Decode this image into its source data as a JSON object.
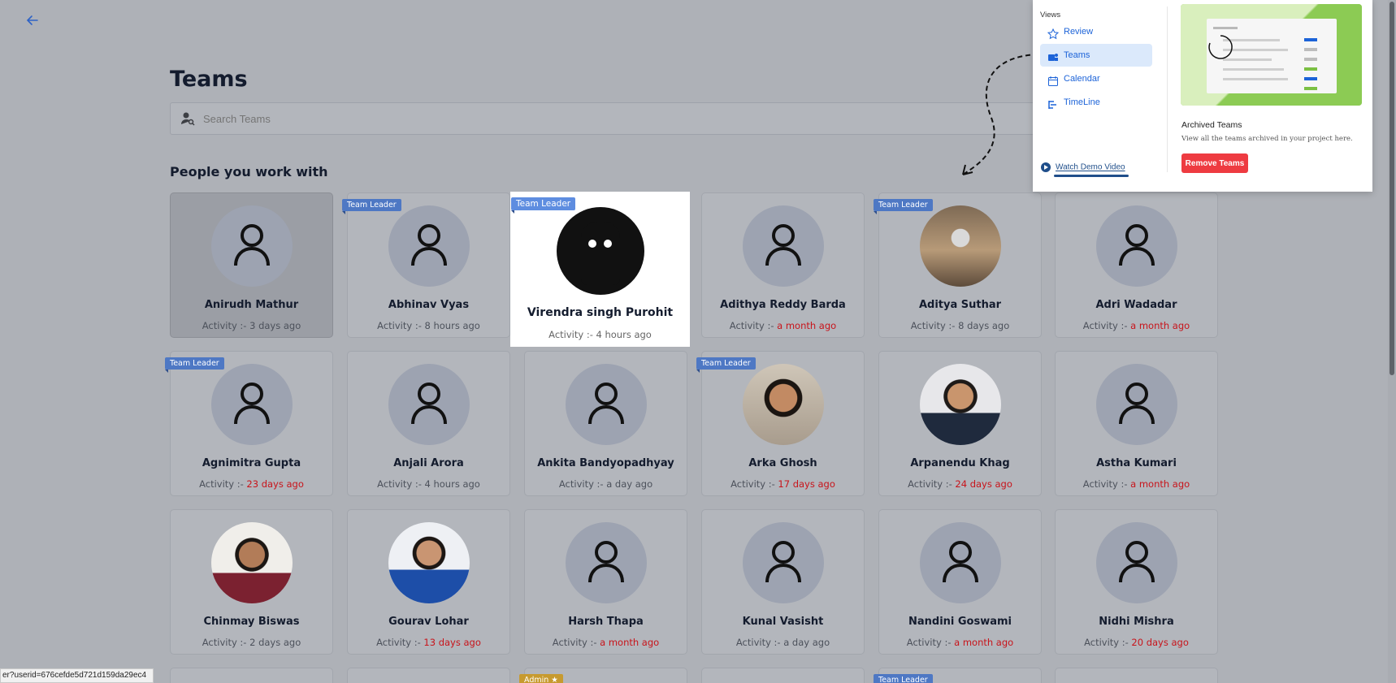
{
  "page": {
    "title": "Teams",
    "search_placeholder": "Search Teams",
    "section_title": "People you work with",
    "status_url": "er?userid=676cefde5d721d159da29ec4"
  },
  "members": [
    {
      "name": "Anirudh Mathur",
      "activity_label": "Activity :-",
      "activity": "3 days ago",
      "recent": true,
      "tag": "",
      "avatar": "placeholder"
    },
    {
      "name": "Abhinav Vyas",
      "activity_label": "Activity :-",
      "activity": "8 hours ago",
      "recent": true,
      "tag": "Team Leader",
      "avatar": "placeholder"
    },
    {
      "name": "Virendra singh Purohit",
      "activity_label": "Activity :-",
      "activity": "4 hours ago",
      "recent": true,
      "tag": "Team Leader",
      "avatar": "cat-art"
    },
    {
      "name": "Adithya Reddy Barda",
      "activity_label": "Activity :-",
      "activity": "a month ago",
      "recent": false,
      "tag": "",
      "avatar": "placeholder"
    },
    {
      "name": "Aditya Suthar",
      "activity_label": "Activity :-",
      "activity": "8 days ago",
      "recent": true,
      "tag": "Team Leader",
      "avatar": "photo"
    },
    {
      "name": "Adri Wadadar",
      "activity_label": "Activity :-",
      "activity": "a month ago",
      "recent": false,
      "tag": "",
      "avatar": "placeholder"
    },
    {
      "name": "Agnimitra Gupta",
      "activity_label": "Activity :-",
      "activity": "23 days ago",
      "recent": false,
      "tag": "Team Leader",
      "avatar": "placeholder"
    },
    {
      "name": "Anjali Arora",
      "activity_label": "Activity :-",
      "activity": "4 hours ago",
      "recent": true,
      "tag": "",
      "avatar": "placeholder"
    },
    {
      "name": "Ankita Bandyopadhyay",
      "activity_label": "Activity :-",
      "activity": "a day ago",
      "recent": true,
      "tag": "",
      "avatar": "placeholder"
    },
    {
      "name": "Arka Ghosh",
      "activity_label": "Activity :-",
      "activity": "17 days ago",
      "recent": false,
      "tag": "Team Leader",
      "avatar": "photo"
    },
    {
      "name": "Arpanendu Khag",
      "activity_label": "Activity :-",
      "activity": "24 days ago",
      "recent": false,
      "tag": "",
      "avatar": "photo"
    },
    {
      "name": "Astha Kumari",
      "activity_label": "Activity :-",
      "activity": "a month ago",
      "recent": false,
      "tag": "",
      "avatar": "placeholder"
    },
    {
      "name": "Chinmay Biswas",
      "activity_label": "Activity :-",
      "activity": "2 days ago",
      "recent": true,
      "tag": "",
      "avatar": "photo"
    },
    {
      "name": "Gourav Lohar",
      "activity_label": "Activity :-",
      "activity": "13 days ago",
      "recent": false,
      "tag": "",
      "avatar": "photo"
    },
    {
      "name": "Harsh Thapa",
      "activity_label": "Activity :-",
      "activity": "a month ago",
      "recent": false,
      "tag": "",
      "avatar": "placeholder"
    },
    {
      "name": "Kunal Vasisht",
      "activity_label": "Activity :-",
      "activity": "a day ago",
      "recent": true,
      "tag": "",
      "avatar": "placeholder"
    },
    {
      "name": "Nandini Goswami",
      "activity_label": "Activity :-",
      "activity": "a month ago",
      "recent": false,
      "tag": "",
      "avatar": "placeholder"
    },
    {
      "name": "Nidhi Mishra",
      "activity_label": "Activity :-",
      "activity": "20 days ago",
      "recent": false,
      "tag": "",
      "avatar": "placeholder"
    }
  ],
  "partial_row_tags": [
    "Admin ★",
    "Team Leader"
  ],
  "popover": {
    "views_label": "Views",
    "views": [
      {
        "label": "Review",
        "icon": "star-icon",
        "active": false
      },
      {
        "label": "Teams",
        "icon": "teams-icon",
        "active": true
      },
      {
        "label": "Calendar",
        "icon": "calendar-icon",
        "active": false
      },
      {
        "label": "TimeLine",
        "icon": "timeline-icon",
        "active": false
      }
    ],
    "watch_demo": "Watch Demo Video",
    "archived_title": "Archived Teams",
    "archived_desc": "View all the teams archived in your project here.",
    "remove_button": "Remove Teams"
  },
  "colors": {
    "accent": "#1c63d8",
    "danger": "#ee3b41",
    "recent_red": "#c8141b",
    "tag_blue": "#4e78c4"
  }
}
